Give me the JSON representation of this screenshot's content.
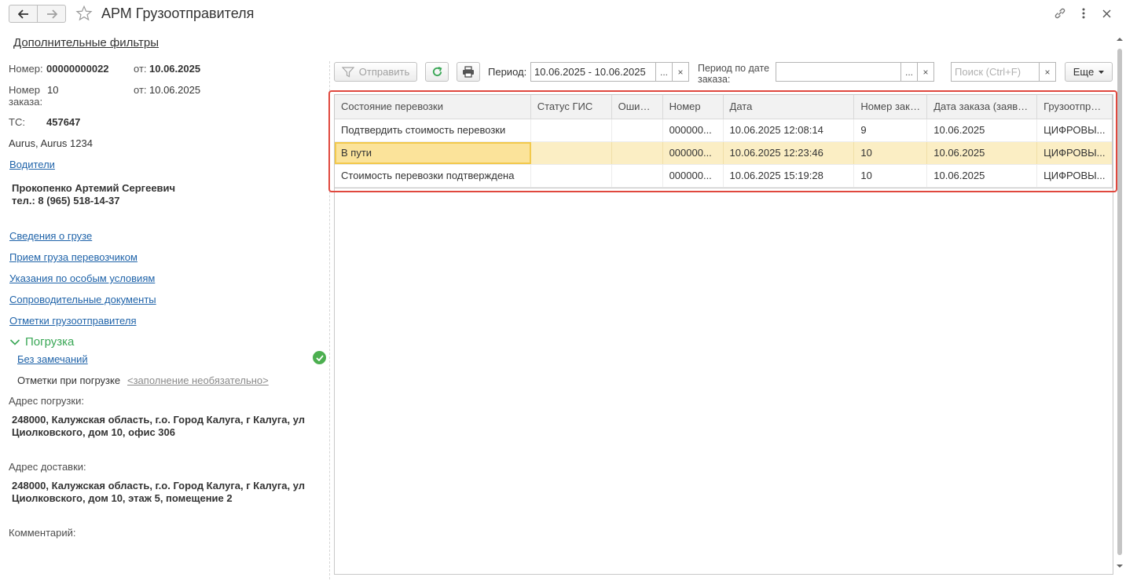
{
  "window": {
    "title": "АРМ Грузоотправителя"
  },
  "filters": {
    "link": "Дополнительные фильтры"
  },
  "left": {
    "number_label": "Номер:",
    "number_value": "00000000022",
    "number_date_label": "от:",
    "number_date_value": "10.06.2025",
    "order_label": "Номер заказа:",
    "order_value": "10",
    "order_date_label": "от:",
    "order_date_value": "10.06.2025",
    "vehicle_label": "ТС:",
    "vehicle_value": "457647",
    "vehicle_model": "Aurus, Aurus 1234",
    "drivers_link": "Водители",
    "driver_name": "Прокопенко Артемий Сергеевич",
    "driver_phone": "тел.: 8 (965) 518-14-37",
    "links": [
      "Сведения о грузе",
      "Прием груза перевозчиком",
      "Указания по особым условиям",
      "Сопроводительные документы",
      "Отметки грузоотправителя"
    ],
    "loading_section": "Погрузка",
    "no_remarks_link": "Без замечаний",
    "loading_marks_label": "Отметки при погрузке",
    "loading_marks_placeholder": "<заполнение необязательно>",
    "loading_address_label": "Адрес погрузки:",
    "loading_address_value": "248000, Калужская область, г.о. Город Калуга, г Калуга, ул Циолковского, дом 10, офис 306",
    "delivery_address_label": "Адрес доставки:",
    "delivery_address_value": "248000, Калужская область, г.о. Город Калуга, г Калуга, ул Циолковского, дом 10, этаж 5, помещение 2",
    "comment_label": "Комментарий:"
  },
  "toolbar": {
    "send_label": "Отправить",
    "period_label": "Период:",
    "period_value": "10.06.2025 - 10.06.2025",
    "order_period_label": "Период по дате заказа:",
    "order_period_value": "",
    "search_placeholder": "Поиск (Ctrl+F)",
    "more_label": "Еще",
    "ellipsis": "...",
    "clear": "×"
  },
  "table": {
    "columns": [
      "Состояние перевозки",
      "Статус ГИС",
      "Ошибка",
      "Номер",
      "Дата",
      "Номер зака...",
      "Дата заказа (заявки)",
      "Грузоотправ..."
    ],
    "rows": [
      [
        "Подтвердить стоимость перевозки",
        "",
        "",
        "000000...",
        "10.06.2025 12:08:14",
        "9",
        "10.06.2025",
        "ЦИФРОВЫ..."
      ],
      [
        "В пути",
        "",
        "",
        "000000...",
        "10.06.2025 12:23:46",
        "10",
        "10.06.2025",
        "ЦИФРОВЫ..."
      ],
      [
        "Стоимость перевозки подтверждена",
        "",
        "",
        "000000...",
        "10.06.2025 15:19:28",
        "10",
        "10.06.2025",
        "ЦИФРОВЫ..."
      ]
    ]
  },
  "colors": {
    "accent_green": "#3aa756",
    "link_blue": "#1f63a9",
    "highlight_red": "#e0483e",
    "selected_row": "#fbeec4"
  }
}
